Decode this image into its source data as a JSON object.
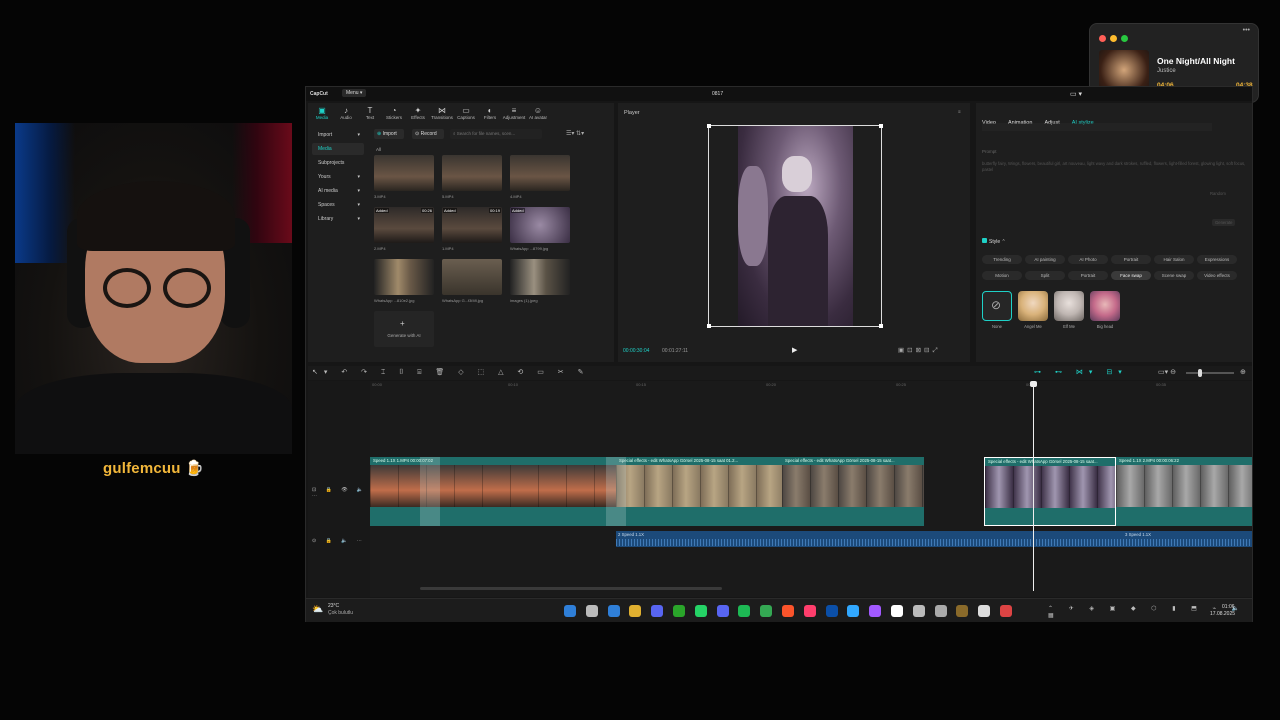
{
  "streamer": {
    "name": "gulfemcuu 🍺"
  },
  "music": {
    "title": "One Night/All Night",
    "artist": "Justice",
    "current": "04:06",
    "total": "04:38",
    "progress": 0.88
  },
  "app": {
    "brand": "CapCut",
    "menu_label": "Menu ▾",
    "project_name": "0817",
    "tools": [
      {
        "label": "Media",
        "icon": "▣"
      },
      {
        "label": "Audio",
        "icon": "♪"
      },
      {
        "label": "Text",
        "icon": "T"
      },
      {
        "label": "Stickers",
        "icon": "◔"
      },
      {
        "label": "Effects",
        "icon": "✦"
      },
      {
        "label": "Transitions",
        "icon": "⋈"
      },
      {
        "label": "Captions",
        "icon": "▭"
      },
      {
        "label": "Filters",
        "icon": "◐"
      },
      {
        "label": "Adjustment",
        "icon": "≡"
      },
      {
        "label": "AI avatar",
        "icon": "☺"
      }
    ],
    "sidebar": [
      {
        "label": "Import",
        "arrow": "▾"
      },
      {
        "label": "Media",
        "arrow": ""
      },
      {
        "label": "Subprojects",
        "arrow": ""
      },
      {
        "label": "Yours",
        "arrow": "▾"
      },
      {
        "label": "AI media",
        "arrow": "▾"
      },
      {
        "label": "Spaces",
        "arrow": "▾"
      },
      {
        "label": "Library",
        "arrow": "▾"
      }
    ],
    "media": {
      "import_btn": "Import",
      "record_btn": "Record",
      "search_placeholder": "Search for file names, scen...",
      "filter_label": "All",
      "items": [
        {
          "name": "3.MP4",
          "badge": "",
          "dur": ""
        },
        {
          "name": "5.MP4",
          "badge": "",
          "dur": ""
        },
        {
          "name": "4.MP4",
          "badge": "",
          "dur": ""
        },
        {
          "name": "2.MP4",
          "badge": "Added",
          "dur": "00:26"
        },
        {
          "name": "1.MP4",
          "badge": "Added",
          "dur": "00:19"
        },
        {
          "name": "WhatsApp ...8799.jpg",
          "badge": "Added",
          "dur": ""
        },
        {
          "name": "WhatsApp ...810e2.jpg",
          "badge": "",
          "dur": ""
        },
        {
          "name": "WhatsApp G...f3f4fl.jpg",
          "badge": "",
          "dur": ""
        },
        {
          "name": "images (1).jpeg",
          "badge": "",
          "dur": ""
        }
      ],
      "generate_label": "Generate with AI"
    },
    "player": {
      "title": "Player",
      "current": "00:00:30:04",
      "total": "00:01:27:11",
      "play_icon": "▶"
    },
    "inspector": {
      "tabs": [
        "Video",
        "Animation",
        "Adjust",
        "AI stylize"
      ],
      "prompt_label": "Prompt",
      "prompt_text": "butterfly fairy, Wings, flowers, beautiful girl, art nouveau, light wavy and dark strokes, ruffled, flowers, light-filled forest, glowing light, soft focus, pastel",
      "random_label": "Random",
      "generate_label": "Generate",
      "style_label": "Style ⌃",
      "style_pills_row1": [
        "Trending",
        "AI painting",
        "AI Photo",
        "Portrait",
        "Hair Salon",
        "Expressions"
      ],
      "style_pills_row2": [
        "Motion",
        "Split",
        "Portrait",
        "Face swap",
        "Scene swap",
        "Video effects"
      ],
      "effects": [
        "None",
        "Angel Me",
        "Elf Me",
        "Big head"
      ]
    },
    "timeline": {
      "ruler": [
        "00:00",
        "00:10",
        "00:15",
        "00:20",
        "00:25",
        "00:30",
        "00:35"
      ],
      "clips": [
        {
          "label": "Speed 1.1X  1.MP4  00:00:07:02",
          "color": "#1f6e6a"
        },
        {
          "label": "Special effects - edit  WhatsApp Görsel 2025-08-15 saat 01.2...",
          "color": "#1f6e6a"
        },
        {
          "label": "Special effects - edit  WhatsApp Görsel 2025-08-15 saat...",
          "color": "#1f6e6a"
        },
        {
          "label": "Special effects - edit  WhatsApp Görsel 2025-08-15 saat...",
          "color": "#1f6e6a"
        },
        {
          "label": "Speed 1.1X  2.MP4  00:00:06:22",
          "color": "#1f6e6a"
        }
      ],
      "audio1": "2   Speed 1.1X",
      "audio2": "3   Speed 1.1X"
    }
  },
  "taskbar": {
    "temp": "23°C",
    "weather": "Çok bulutlu",
    "time": "01:06",
    "date": "17.08.2025"
  },
  "colors": {
    "accent": "#1fd1c7",
    "gold": "#f2b73a",
    "clip": "#1f6e6a",
    "audio": "#1c4a7a"
  }
}
